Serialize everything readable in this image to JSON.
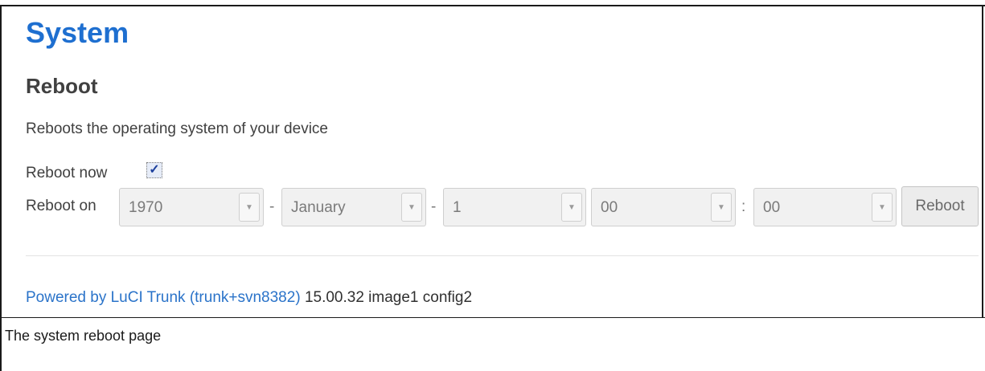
{
  "page": {
    "title": "System",
    "section_title": "Reboot",
    "description": "Reboots the operating system of your device"
  },
  "reboot_now": {
    "label": "Reboot now",
    "checked": true
  },
  "reboot_on": {
    "label": "Reboot on",
    "year": "1970",
    "month": "January",
    "day": "1",
    "hour": "00",
    "minute": "00",
    "sep_date": "-",
    "sep_time": ":",
    "button_label": "Reboot"
  },
  "footer": {
    "link_text": "Powered by LuCI Trunk (trunk+svn8382)",
    "version_text": "15.00.32 image1 config2"
  },
  "caption": "The system reboot page",
  "colors": {
    "title": "#1e6fd0",
    "link": "#2a73c9",
    "text": "#404040"
  }
}
